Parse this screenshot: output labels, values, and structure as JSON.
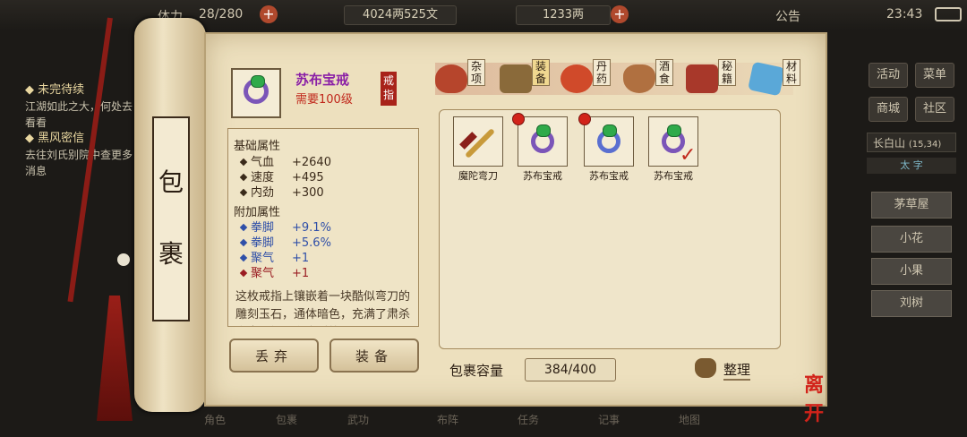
{
  "topbar": {
    "partial_left": "体力",
    "stamina": "28/280",
    "money": "4024两525文",
    "gold": "1233两",
    "announcement": "公告",
    "time": "23:43"
  },
  "quests": [
    {
      "title": "未完待续",
      "text": "江湖如此之大，何处去看看"
    },
    {
      "title": "黑风密信",
      "text": "去往刘氏别院中查更多消息"
    }
  ],
  "right_menu": [
    "活动",
    "菜单",
    "商城",
    "社区"
  ],
  "location": {
    "name": "长白山",
    "coords": "(15,34)"
  },
  "location_tabs": [
    "太",
    "字"
  ],
  "npcs": [
    "茅草屋",
    "小花",
    "小果",
    "刘树"
  ],
  "scroll_title": [
    "包",
    "裹"
  ],
  "item": {
    "name": "苏布宝戒",
    "requirement": "需要100级",
    "type_tag": "戒指",
    "base_header": "基础属性",
    "base_stats": [
      {
        "name": "气血",
        "value": "+2640"
      },
      {
        "name": "速度",
        "value": "+495"
      },
      {
        "name": "内劲",
        "value": "+300"
      }
    ],
    "extra_header": "附加属性",
    "extra_stats": [
      {
        "name": "拳脚",
        "value": "+9.1%",
        "color": "blue"
      },
      {
        "name": "拳脚",
        "value": "+5.6%",
        "color": "blue"
      },
      {
        "name": "聚气",
        "value": "+1",
        "color": "blue"
      },
      {
        "name": "聚气",
        "value": "+1",
        "color": "red"
      }
    ],
    "description": "这枚戒指上镶嵌着一块酷似弯刀的雕刻玉石，通体暗色，充满了肃杀之意，好似在击时能"
  },
  "actions": {
    "discard": "丢弃",
    "equip": "装备"
  },
  "categories": [
    {
      "label": "杂项"
    },
    {
      "label": "装备"
    },
    {
      "label": "丹药"
    },
    {
      "label": "酒食"
    },
    {
      "label": "秘籍"
    },
    {
      "label": "材料"
    }
  ],
  "inventory": [
    {
      "name": "魔陀弯刀",
      "kind": "sword",
      "new": false,
      "equipped": false
    },
    {
      "name": "苏布宝戒",
      "kind": "ring",
      "new": true,
      "equipped": false
    },
    {
      "name": "苏布宝戒",
      "kind": "ring-blue",
      "new": true,
      "equipped": false
    },
    {
      "name": "苏布宝戒",
      "kind": "ring",
      "new": false,
      "equipped": true
    }
  ],
  "capacity_label": "包裹容量",
  "capacity": "384/400",
  "sort_label": "整理",
  "leave_label": "离开",
  "bottom_nav": [
    "角色",
    "包裹",
    "武功",
    "布阵",
    "任务",
    "记事",
    "地图"
  ]
}
